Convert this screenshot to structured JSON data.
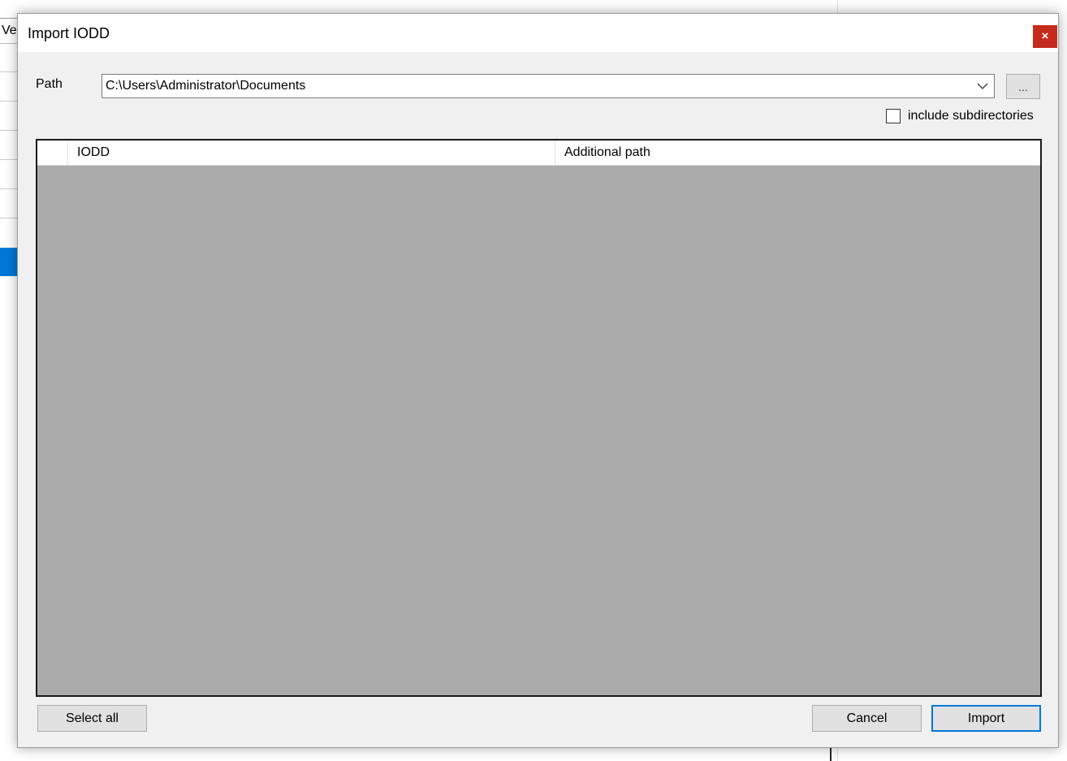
{
  "background": {
    "left_header_text": "Ve"
  },
  "dialog": {
    "title": "Import IODD",
    "close_label": "×",
    "path_label": "Path",
    "path_value": "C:\\Users\\Administrator\\Documents",
    "browse_label": "...",
    "include_subdirectories_label": "include subdirectories",
    "include_subdirectories_checked": false,
    "columns": [
      "",
      "IODD",
      "Additional path"
    ],
    "rows": [],
    "buttons": {
      "select_all": "Select all",
      "cancel": "Cancel",
      "import": "Import"
    },
    "colors": {
      "close_button": "#c42b1c",
      "accent": "#0078d7",
      "grid_empty_area": "#ababab"
    }
  }
}
